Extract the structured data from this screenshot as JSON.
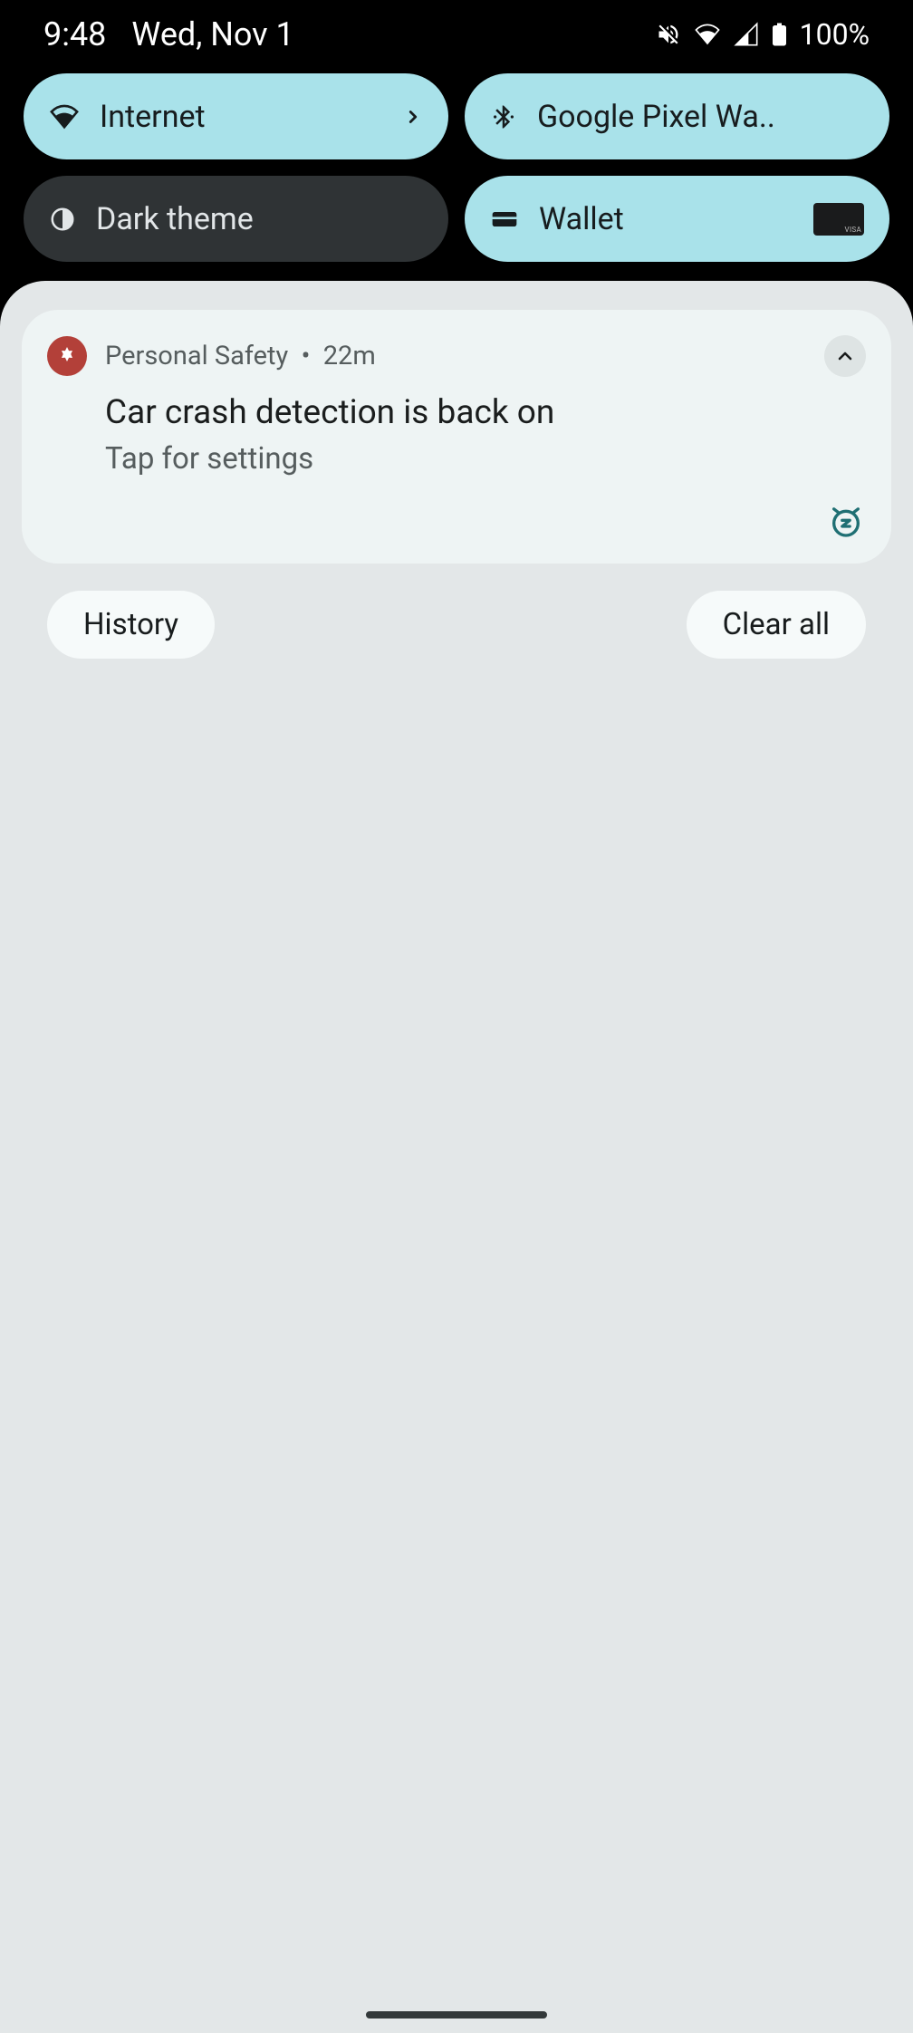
{
  "status": {
    "time": "9:48",
    "date": "Wed, Nov 1",
    "battery": "100%"
  },
  "qs": {
    "internet": {
      "label": "Internet"
    },
    "bluetooth": {
      "label": "Google Pixel Wa.."
    },
    "dark_theme": {
      "label": "Dark theme"
    },
    "wallet": {
      "label": "Wallet"
    }
  },
  "notification": {
    "app_name": "Personal Safety",
    "time": "22m",
    "title": "Car crash detection is back on",
    "subtitle": "Tap for settings"
  },
  "panel": {
    "history_label": "History",
    "clear_label": "Clear all"
  }
}
